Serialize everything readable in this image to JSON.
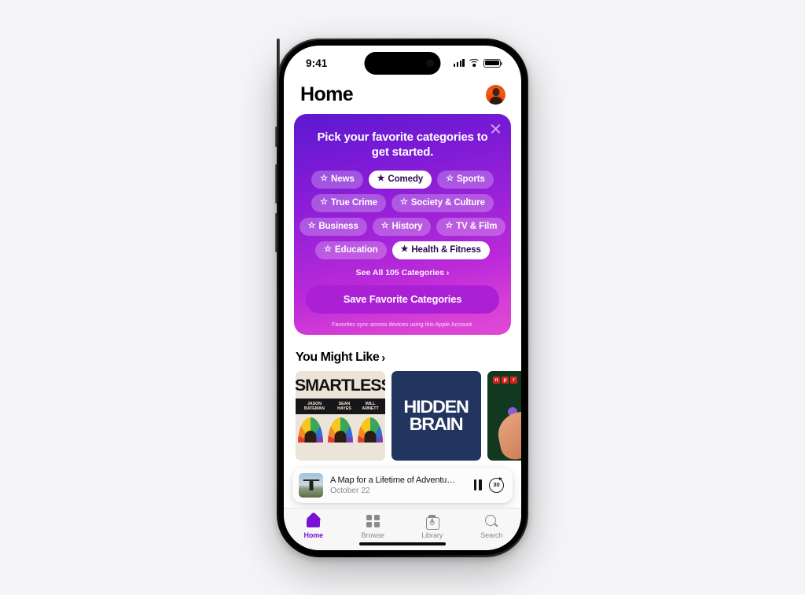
{
  "status_bar": {
    "time": "9:41",
    "cellular_icon": "cellular-bars-icon",
    "wifi_icon": "wifi-icon",
    "battery_icon": "battery-full-icon"
  },
  "header": {
    "title": "Home",
    "avatar_label": "Account"
  },
  "promo_card": {
    "title": "Pick your favorite categories to get started.",
    "close_label": "Close",
    "see_all_label": "See All 105 Categories ›",
    "save_label": "Save Favorite Categories",
    "footnote": "Favorites sync across devices using this Apple Account.",
    "gradient_from": "#5b19cf",
    "gradient_to": "#e04ad4",
    "save_button_color": "#ab20d4",
    "category_rows": [
      [
        {
          "label": "News",
          "selected": false,
          "star": "☆"
        },
        {
          "label": "Comedy",
          "selected": true,
          "star": "★"
        },
        {
          "label": "Sports",
          "selected": false,
          "star": "☆"
        }
      ],
      [
        {
          "label": "True Crime",
          "selected": false,
          "star": "☆"
        },
        {
          "label": "Society & Culture",
          "selected": false,
          "star": "☆"
        }
      ],
      [
        {
          "label": "Business",
          "selected": false,
          "star": "☆"
        },
        {
          "label": "History",
          "selected": false,
          "star": "☆"
        },
        {
          "label": "TV & Film",
          "selected": false,
          "star": "☆"
        }
      ],
      [
        {
          "label": "Education",
          "selected": false,
          "star": "☆"
        },
        {
          "label": "Health & Fitness",
          "selected": true,
          "star": "★"
        }
      ]
    ]
  },
  "you_might_like": {
    "title": "You Might Like",
    "chevron": "›",
    "podcasts": [
      {
        "name": "SMARTLESS",
        "hosts": [
          "JASON BATEMAN",
          "SEAN HAYES",
          "WILL ARNETT"
        ],
        "bg_color": "#ece4d8"
      },
      {
        "name": "HIDDEN BRAIN",
        "line1": "HIDDEN",
        "line2": "BRAIN",
        "bg_color": "#21355e"
      },
      {
        "name": "NPR",
        "logo_letters": [
          "n",
          "p",
          "r"
        ],
        "bg_color": "#12381f"
      }
    ]
  },
  "now_playing": {
    "title": "A Map for a Lifetime of Adventu…",
    "subtitle": "October 22",
    "pause_icon": "pause-icon",
    "skip_icon": "skip-forward-30-icon",
    "skip_label": "30"
  },
  "tab_bar": {
    "active_color": "#7a10d4",
    "inactive_color": "#8a8a8e",
    "tabs": [
      {
        "label": "Home",
        "icon": "home-icon",
        "active": true
      },
      {
        "label": "Browse",
        "icon": "grid-icon",
        "active": false
      },
      {
        "label": "Library",
        "icon": "library-icon",
        "active": false
      },
      {
        "label": "Search",
        "icon": "search-icon",
        "active": false
      }
    ]
  }
}
